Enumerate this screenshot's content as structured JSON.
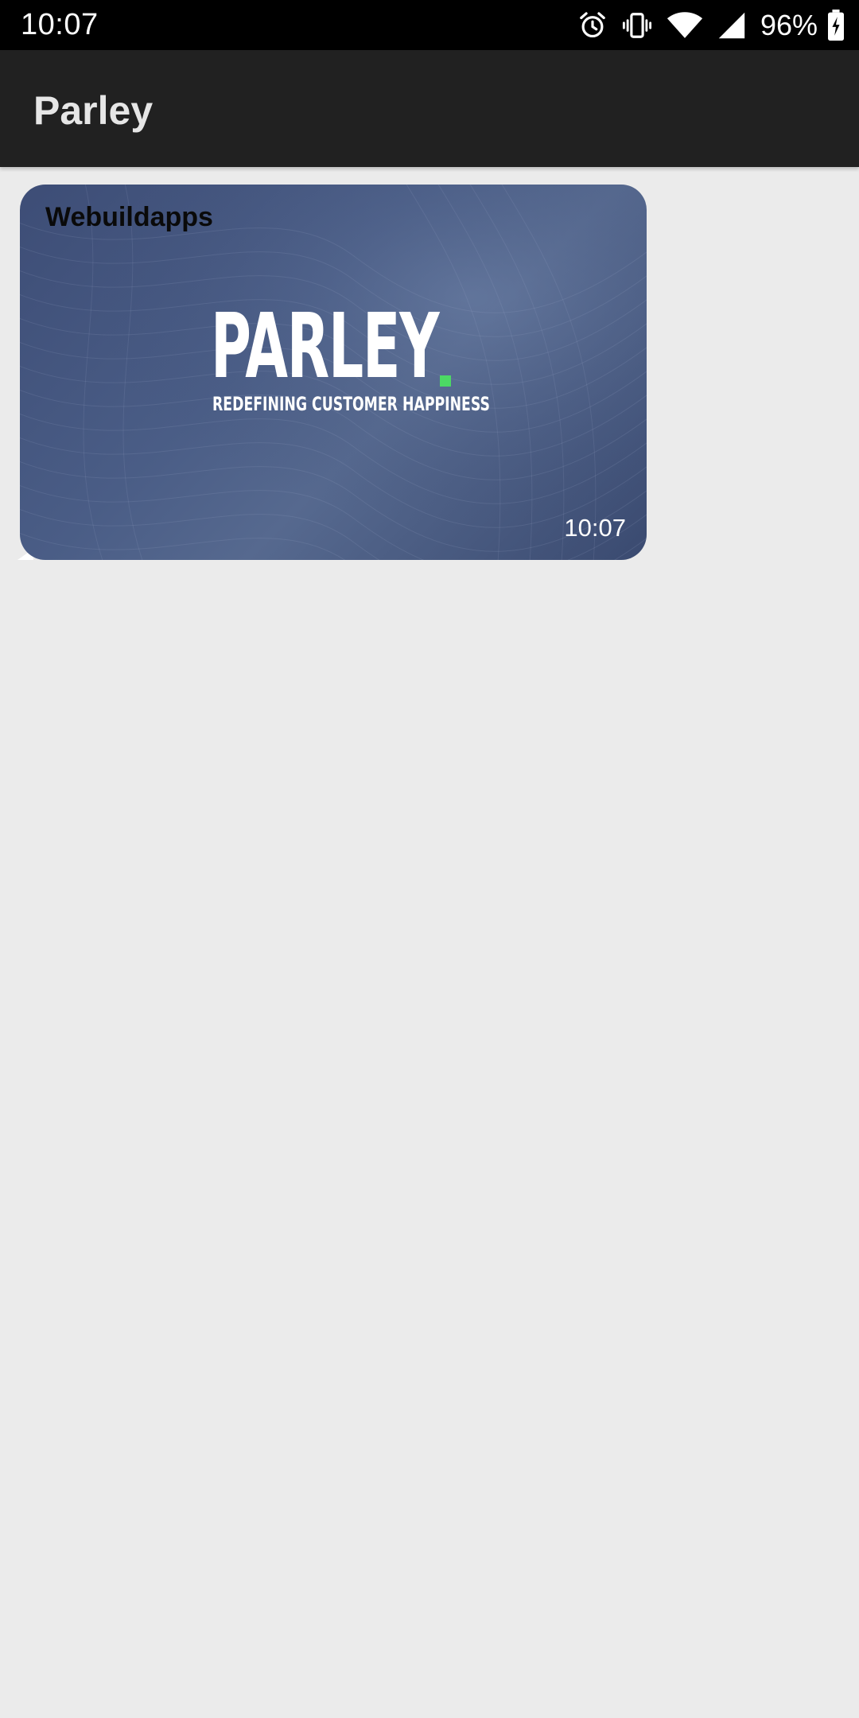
{
  "status_bar": {
    "time": "10:07",
    "battery_percent": "96%",
    "icons": [
      "alarm-icon",
      "vibrate-icon",
      "wifi-icon",
      "signal-icon",
      "battery-charging-icon"
    ]
  },
  "app_bar": {
    "title": "Parley"
  },
  "messages": [
    {
      "sender": "Webuildapps",
      "image": {
        "brand_name": "PARLEY",
        "brand_dot": ".",
        "tagline": "REDEFINING CUSTOMER HAPPINESS",
        "accent_color": "#4cd964",
        "background_color": "#44557e"
      },
      "time": "10:07"
    }
  ]
}
